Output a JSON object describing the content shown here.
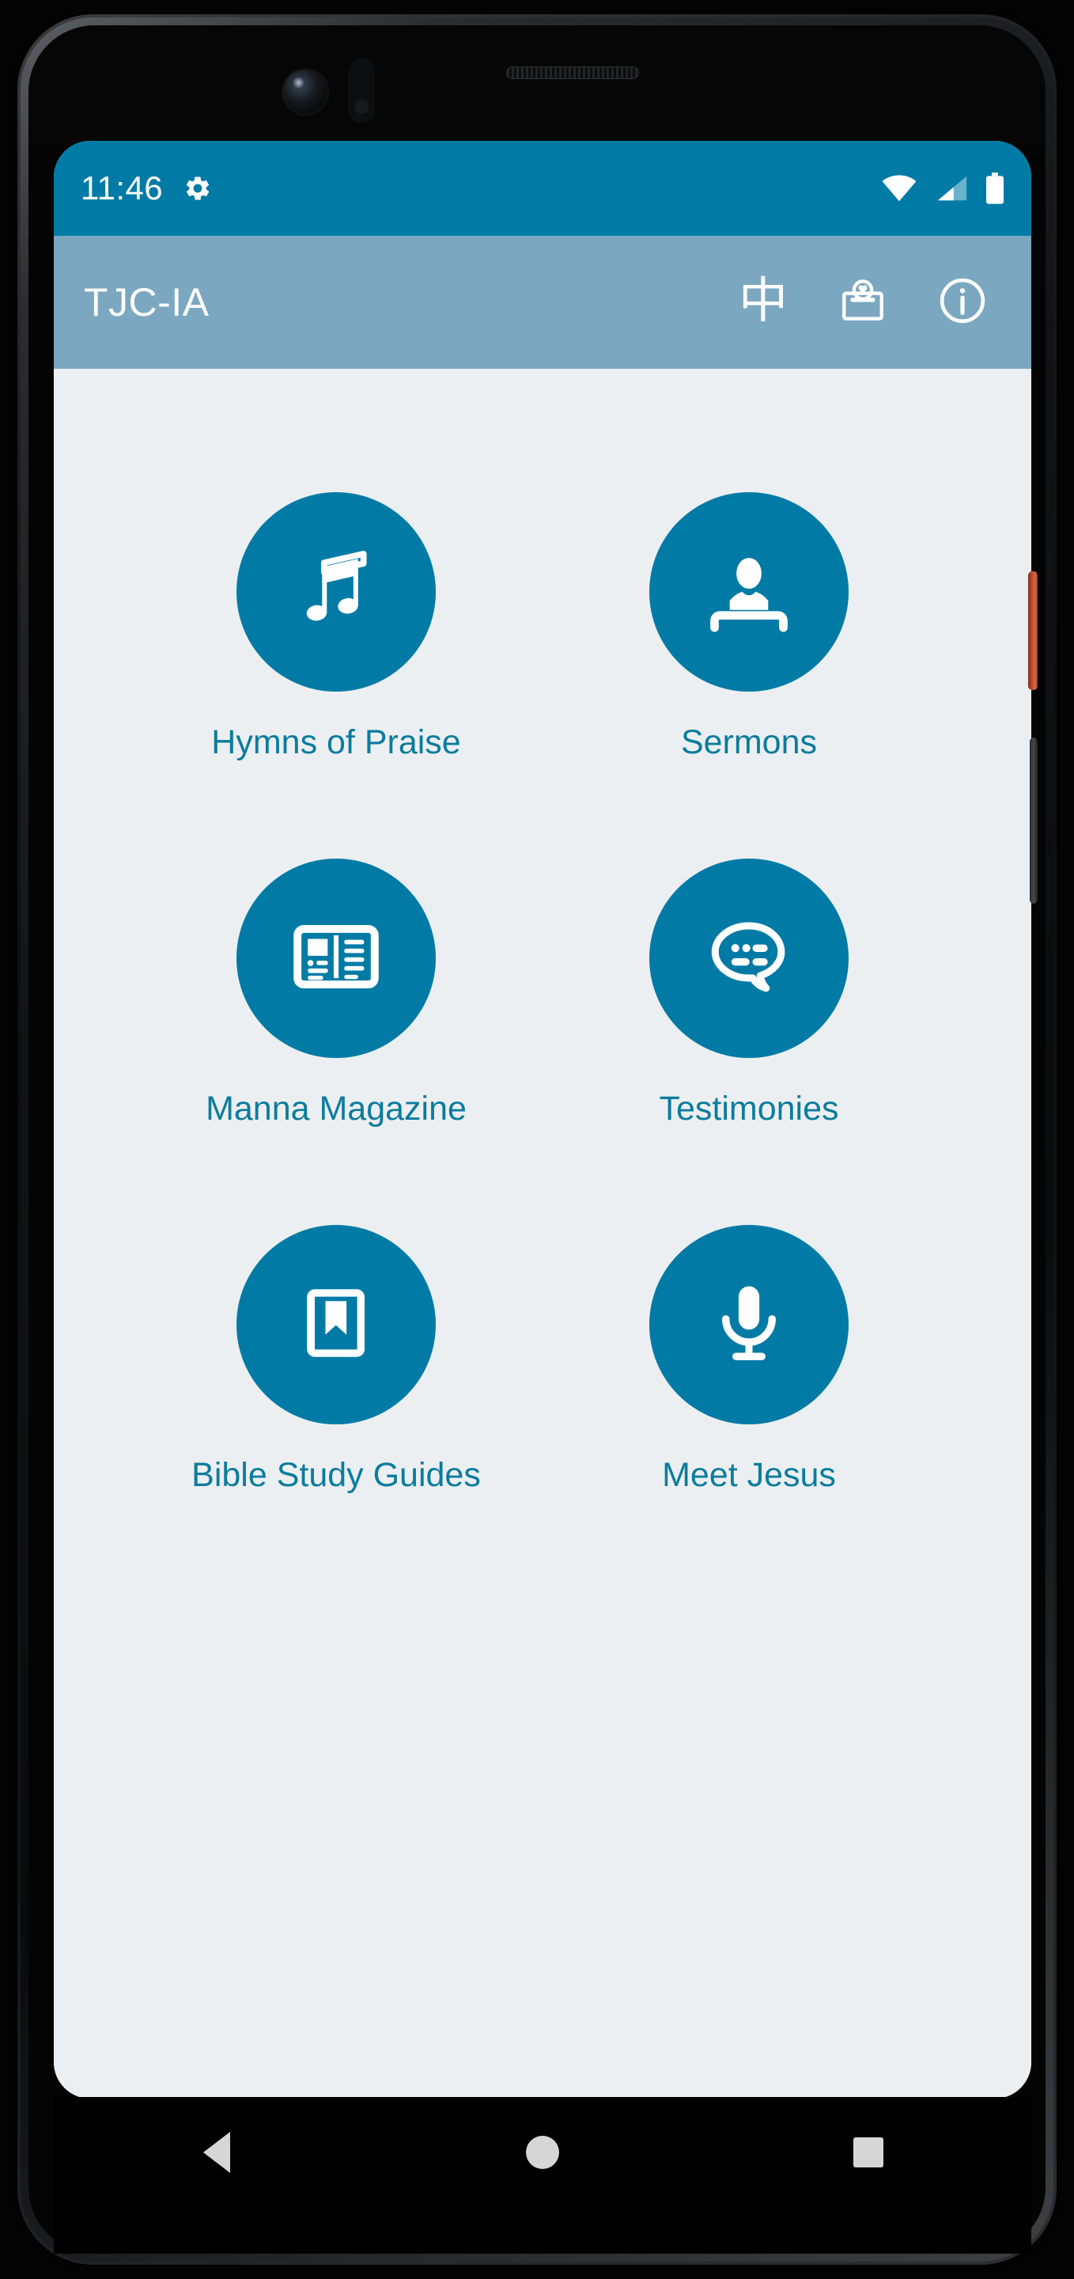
{
  "statusbar": {
    "time": "11:46",
    "icons": [
      "gear-icon",
      "wifi-icon",
      "cellular-signal-icon",
      "battery-icon"
    ]
  },
  "appbar": {
    "title": "TJC-IA",
    "actions": [
      {
        "name": "language-toggle-chinese",
        "glyph": "中"
      },
      {
        "name": "offering-box-icon",
        "glyph": "offering-box"
      },
      {
        "name": "info-icon",
        "glyph": "info-circle"
      }
    ]
  },
  "main": {
    "tiles": [
      {
        "label": "Hymns of Praise",
        "icon": "music-note-icon"
      },
      {
        "label": "Sermons",
        "icon": "preacher-podium-icon"
      },
      {
        "label": "Manna Magazine",
        "icon": "open-magazine-icon"
      },
      {
        "label": "Testimonies",
        "icon": "speech-bubble-icon"
      },
      {
        "label": "Bible Study Guides",
        "icon": "bookmarked-book-icon"
      },
      {
        "label": "Meet Jesus",
        "icon": "microphone-icon"
      }
    ]
  },
  "navbar": {
    "items": [
      {
        "name": "nav-back-button",
        "icon": "triangle-back-icon"
      },
      {
        "name": "nav-home-button",
        "icon": "circle-home-icon"
      },
      {
        "name": "nav-recents-button",
        "icon": "square-recents-icon"
      }
    ]
  },
  "colors": {
    "status_bar": "#017ba6",
    "app_bar": "#7ba7c0",
    "accent": "#017ba6",
    "label_text": "#0b7c9e",
    "screen_bg": "#eceff1"
  }
}
